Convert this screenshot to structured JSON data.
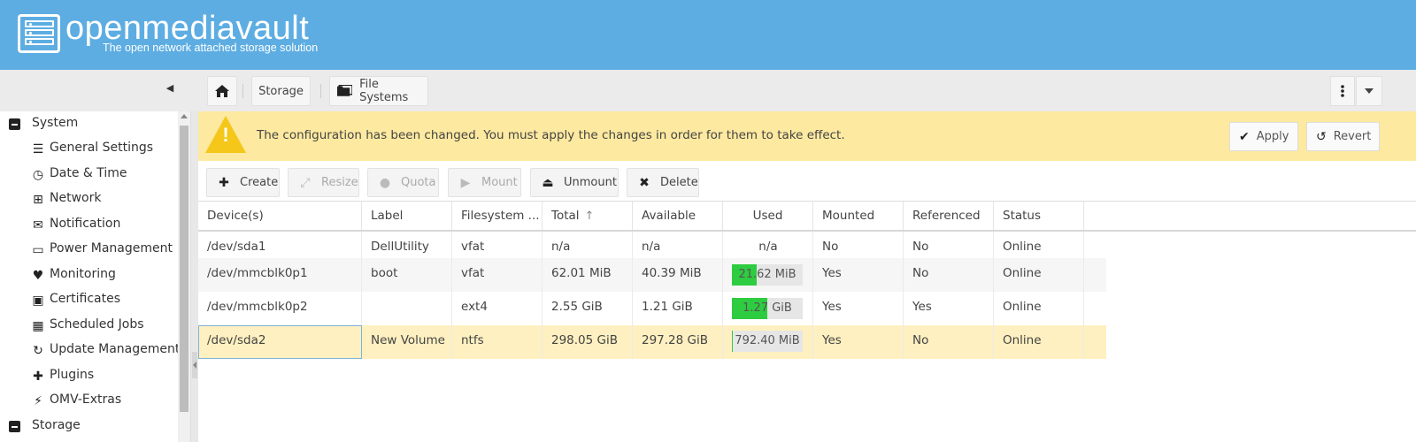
{
  "app": {
    "title": "openmediavault",
    "subtitle": "The open network attached storage solution"
  },
  "breadcrumb": {
    "items": [
      "Storage",
      "File Systems"
    ]
  },
  "sidebar": {
    "groups": [
      {
        "label": "System"
      },
      {
        "label": "Storage"
      }
    ],
    "items": [
      {
        "label": "General Settings",
        "icon": "sliders-icon"
      },
      {
        "label": "Date & Time",
        "icon": "clock-icon"
      },
      {
        "label": "Network",
        "icon": "network-icon"
      },
      {
        "label": "Notification",
        "icon": "envelope-icon"
      },
      {
        "label": "Power Management",
        "icon": "battery-icon"
      },
      {
        "label": "Monitoring",
        "icon": "heartbeat-icon"
      },
      {
        "label": "Certificates",
        "icon": "certificate-icon"
      },
      {
        "label": "Scheduled Jobs",
        "icon": "calendar-icon"
      },
      {
        "label": "Update Management",
        "icon": "refresh-icon"
      },
      {
        "label": "Plugins",
        "icon": "puzzle-icon"
      },
      {
        "label": "OMV-Extras",
        "icon": "plug-icon"
      }
    ]
  },
  "notice": {
    "message": "The configuration has been changed. You must apply the changes in order for them to take effect.",
    "apply_label": "Apply",
    "revert_label": "Revert",
    "color": "#fde9a0"
  },
  "actions": {
    "create": "Create",
    "resize": "Resize",
    "quota": "Quota",
    "mount": "Mount",
    "unmount": "Unmount",
    "delete": "Delete"
  },
  "grid": {
    "columns": [
      "Device(s)",
      "Label",
      "Filesystem ...",
      "Total",
      "Available",
      "Used",
      "Mounted",
      "Referenced",
      "Status"
    ],
    "sorted_column": "Total",
    "rows": [
      {
        "device": "/dev/sda1",
        "label": "DellUtility",
        "fs": "vfat",
        "total": "n/a",
        "available": "n/a",
        "used": "n/a",
        "used_fraction": null,
        "mounted": "No",
        "referenced": "No",
        "status": "Online"
      },
      {
        "device": "/dev/mmcblk0p1",
        "label": "boot",
        "fs": "vfat",
        "total": "62.01 MiB",
        "available": "40.39 MiB",
        "used": "21.62 MiB",
        "used_fraction": 0.35,
        "mounted": "Yes",
        "referenced": "No",
        "status": "Online"
      },
      {
        "device": "/dev/mmcblk0p2",
        "label": "",
        "fs": "ext4",
        "total": "2.55 GiB",
        "available": "1.21 GiB",
        "used": "1.27 GiB",
        "used_fraction": 0.5,
        "mounted": "Yes",
        "referenced": "Yes",
        "status": "Online"
      },
      {
        "device": "/dev/sda2",
        "label": "New Volume",
        "fs": "ntfs",
        "total": "298.05 GiB",
        "available": "297.28 GiB",
        "used": "792.40 MiB",
        "used_fraction": 0.003,
        "mounted": "Yes",
        "referenced": "No",
        "status": "Online"
      }
    ]
  },
  "colors": {
    "header": "#5dade2",
    "used_fill": "#2ecc40",
    "selected_row": "#fef0c0"
  }
}
